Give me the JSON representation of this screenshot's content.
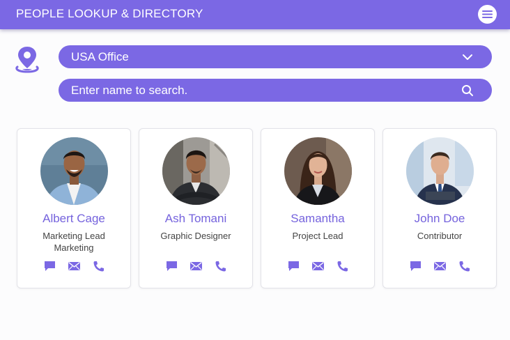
{
  "header": {
    "title": "PEOPLE LOOKUP & DIRECTORY",
    "menu_icon": "hamburger-menu-icon"
  },
  "location": {
    "icon": "map-pin-icon",
    "selected": "USA Office",
    "dropdown_icon": "chevron-down-icon"
  },
  "search": {
    "placeholder": "Enter name to search.",
    "value": "",
    "icon": "search-icon"
  },
  "colors": {
    "accent": "#7b68e4",
    "name_text": "#7563dd",
    "background": "#fcfcfd"
  },
  "people": [
    {
      "name": "Albert Cage",
      "title": "Marketing Lead",
      "department": "Marketing"
    },
    {
      "name": "Ash Tomani",
      "title": "Graphic Designer",
      "department": ""
    },
    {
      "name": "Samantha",
      "title": "Project Lead",
      "department": ""
    },
    {
      "name": "John Doe",
      "title": "Contributor",
      "department": ""
    }
  ],
  "contact_actions": [
    "chat-icon",
    "email-icon",
    "phone-icon"
  ]
}
